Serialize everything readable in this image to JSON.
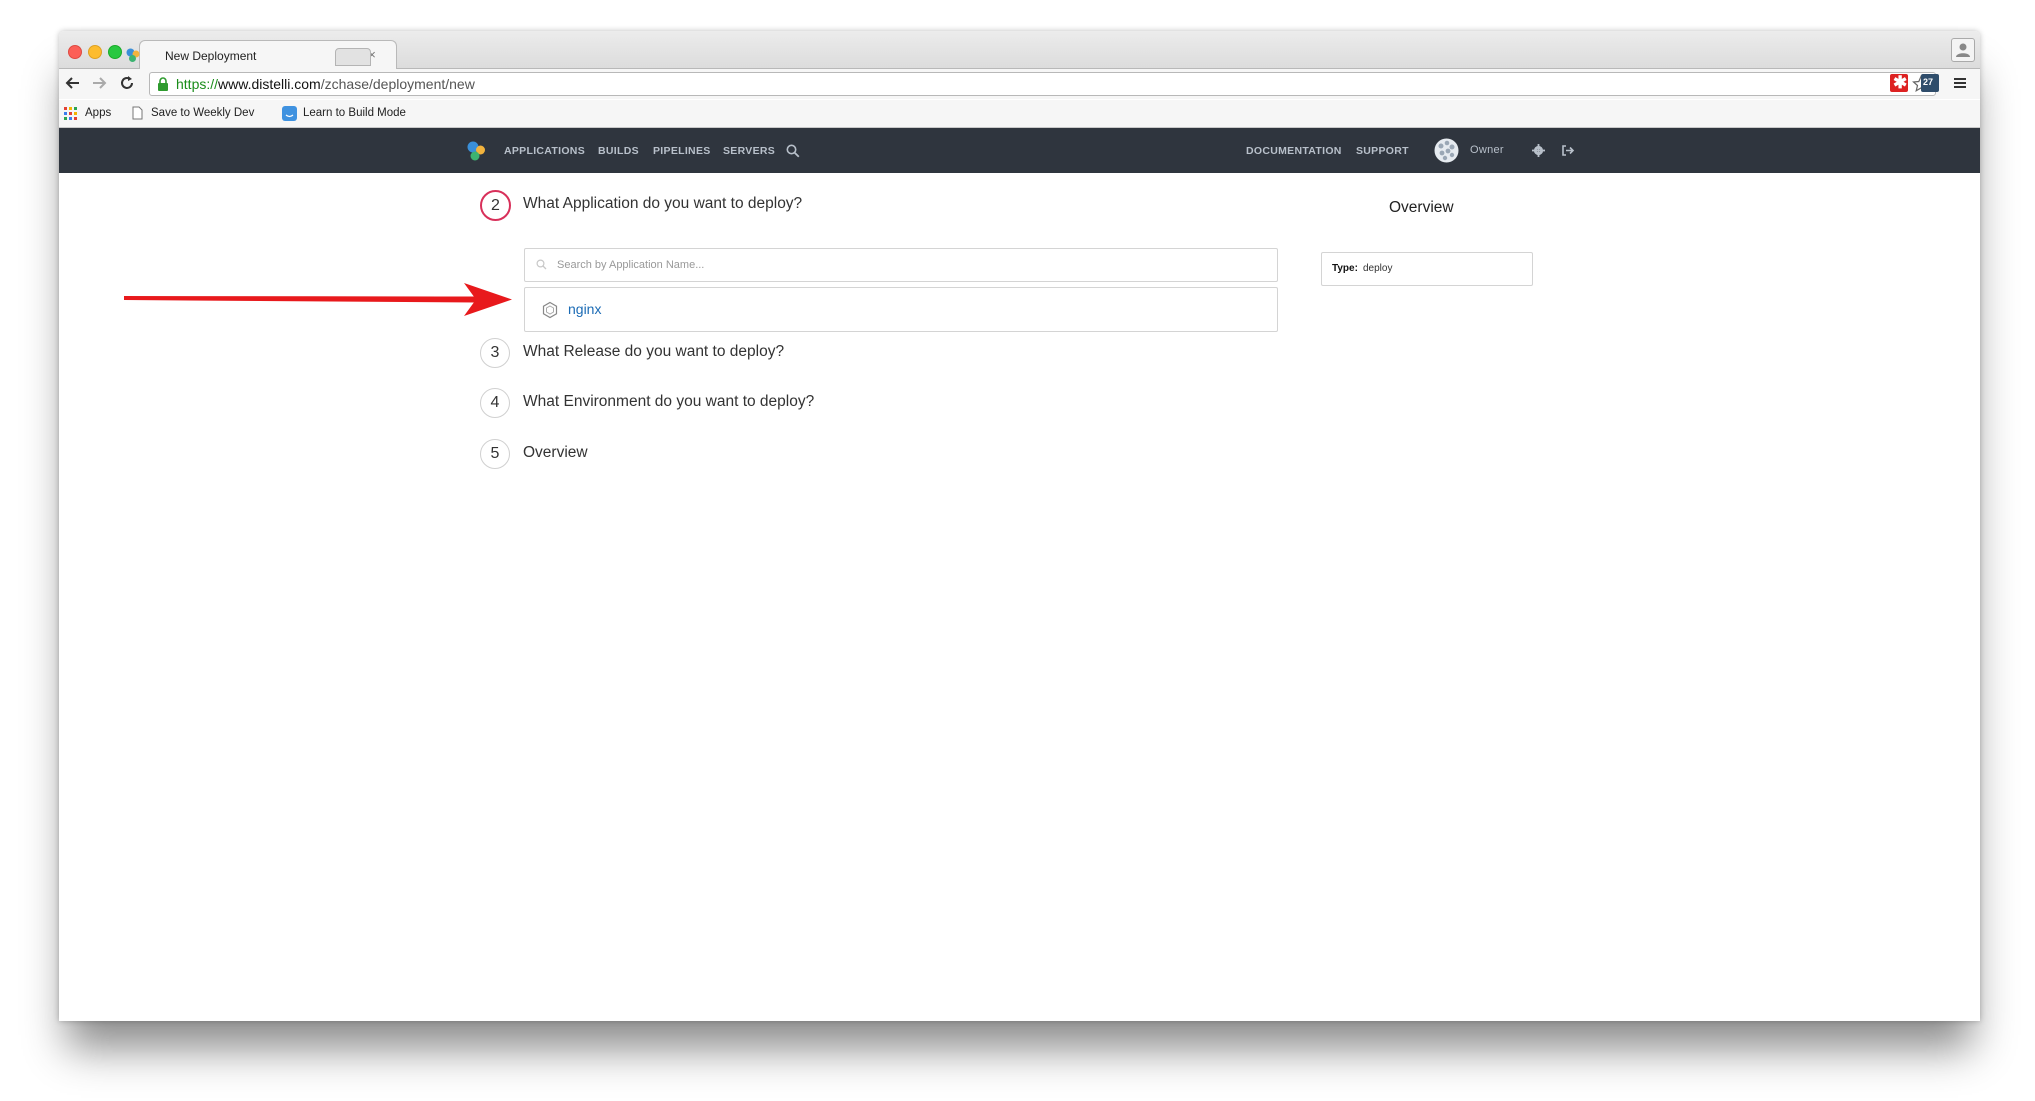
{
  "browser": {
    "tab_title": "New Deployment",
    "tab_close": "×",
    "url_scheme": "https://",
    "url_host": "www.distelli.com",
    "url_path": "/zchase/deployment/new",
    "extension_badge": "27",
    "bookmarks": [
      {
        "label": "Apps"
      },
      {
        "label": "Save to Weekly Dev"
      },
      {
        "label": "Learn to Build Mode"
      }
    ]
  },
  "navbar": {
    "left_items": [
      "APPLICATIONS",
      "BUILDS",
      "PIPELINES",
      "SERVERS"
    ],
    "right_items": [
      "DOCUMENTATION",
      "SUPPORT"
    ],
    "user_label": "Owner"
  },
  "wizard": {
    "steps": [
      {
        "number": "2",
        "question": "What Application do you want to deploy?",
        "active": true
      },
      {
        "number": "3",
        "question": "What Release do you want to deploy?",
        "active": false
      },
      {
        "number": "4",
        "question": "What Environment do you want to deploy?",
        "active": false
      },
      {
        "number": "5",
        "question": "Overview",
        "active": false
      }
    ],
    "search_placeholder": "Search by Application Name...",
    "applications": [
      {
        "name": "nginx"
      }
    ]
  },
  "overview": {
    "title": "Overview",
    "type_label": "Type:",
    "type_value": "deploy"
  },
  "colors": {
    "navbar_bg": "#2f353e",
    "active_step_border": "#d8305a",
    "link_blue": "#1b6bb5",
    "annotation_arrow": "#e8191c"
  }
}
